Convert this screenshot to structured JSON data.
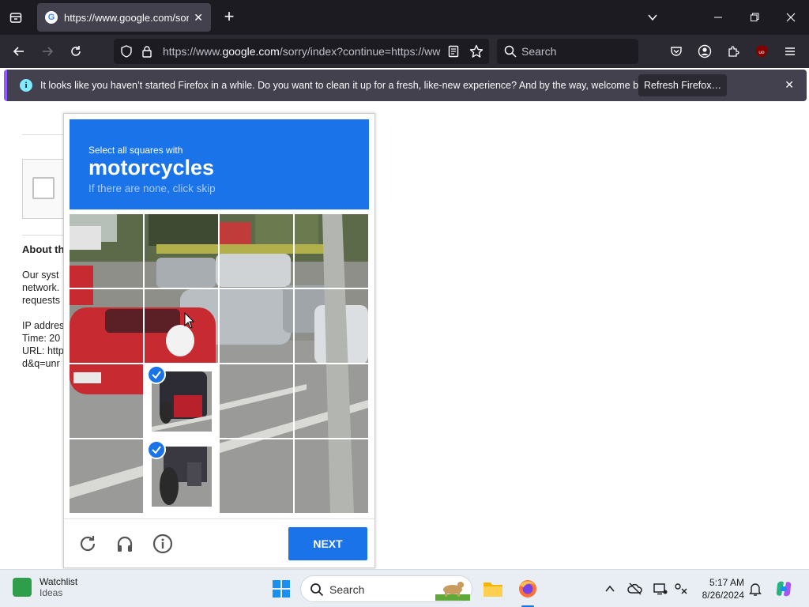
{
  "browser": {
    "tab_title": "https://www.google.com/sorry/",
    "url_host_prefix": "https://www.",
    "url_host": "google.com",
    "url_path": "/sorry/index?continue=https://ww",
    "search_placeholder": "Search",
    "new_tab_symbol": "+",
    "tab_close_symbol": "✕"
  },
  "notification": {
    "message": "It looks like you haven’t started Firefox in a while. Do you want to clean it up for a fresh, like-new experience? And by the way, welcome back!",
    "button_label": "Refresh Firefox…",
    "close_symbol": "✕"
  },
  "page": {
    "about_heading": "About th",
    "body_lines": [
      "Our syst",
      "network.",
      "requests",
      "",
      "IP addres",
      "Time: 20",
      "URL: http",
      "d&q=unr"
    ]
  },
  "captcha": {
    "instruction_small": "Select all squares with",
    "target": "motorcycles",
    "hint": "If there are none, click skip",
    "next_label": "NEXT",
    "selected_tiles": [
      [
        2,
        1
      ],
      [
        3,
        1
      ]
    ]
  },
  "taskbar": {
    "widget_title": "Watchlist",
    "widget_subtitle": "Ideas",
    "search_placeholder": "Search",
    "time": "5:17 AM",
    "date": "8/26/2024"
  },
  "colors": {
    "captcha_blue": "#1a73e8",
    "notification_accent": "#9059ff"
  }
}
